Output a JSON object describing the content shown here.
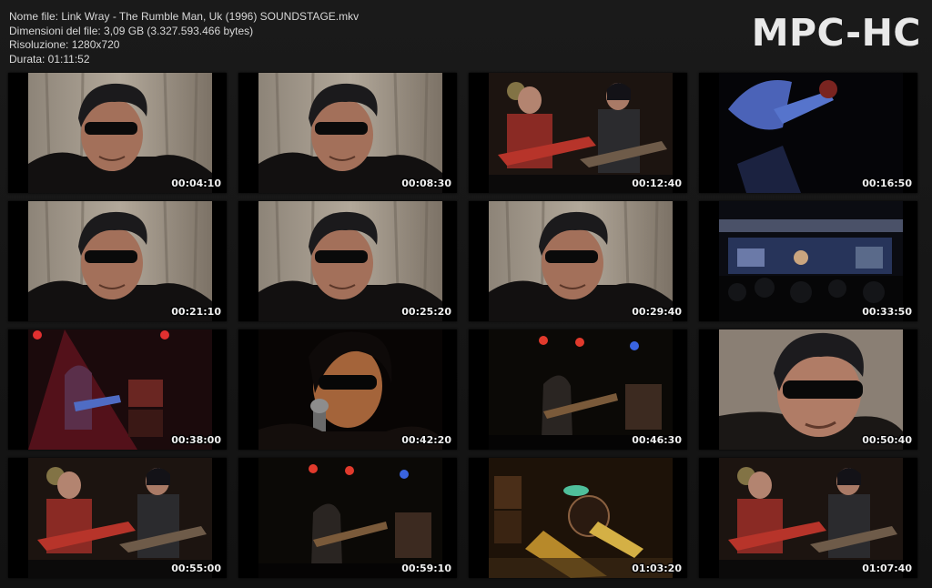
{
  "info": {
    "filename": "Nome file: Link Wray - The Rumble Man, Uk (1996) SOUNDSTAGE.mkv",
    "filesize": "Dimensioni del file: 3,09 GB (3.327.593.466 bytes)",
    "resolution": "Risoluzione: 1280x720",
    "duration": "Durata: 01:11:52"
  },
  "logo": "MPC-HC",
  "thumbnails": [
    {
      "time": "00:04:10",
      "scene": "interview"
    },
    {
      "time": "00:08:30",
      "scene": "interview"
    },
    {
      "time": "00:12:40",
      "scene": "band-stage"
    },
    {
      "time": "00:16:50",
      "scene": "guitar-closeup"
    },
    {
      "time": "00:21:10",
      "scene": "interview"
    },
    {
      "time": "00:25:20",
      "scene": "interview"
    },
    {
      "time": "00:29:40",
      "scene": "interview"
    },
    {
      "time": "00:33:50",
      "scene": "wide-stage"
    },
    {
      "time": "00:38:00",
      "scene": "red-stage"
    },
    {
      "time": "00:42:20",
      "scene": "singer-closeup"
    },
    {
      "time": "00:46:30",
      "scene": "dark-stage"
    },
    {
      "time": "00:50:40",
      "scene": "interview-close"
    },
    {
      "time": "00:55:00",
      "scene": "band-stage"
    },
    {
      "time": "00:59:10",
      "scene": "dark-stage"
    },
    {
      "time": "01:03:20",
      "scene": "drum-stage"
    },
    {
      "time": "01:07:40",
      "scene": "band-stage"
    }
  ]
}
